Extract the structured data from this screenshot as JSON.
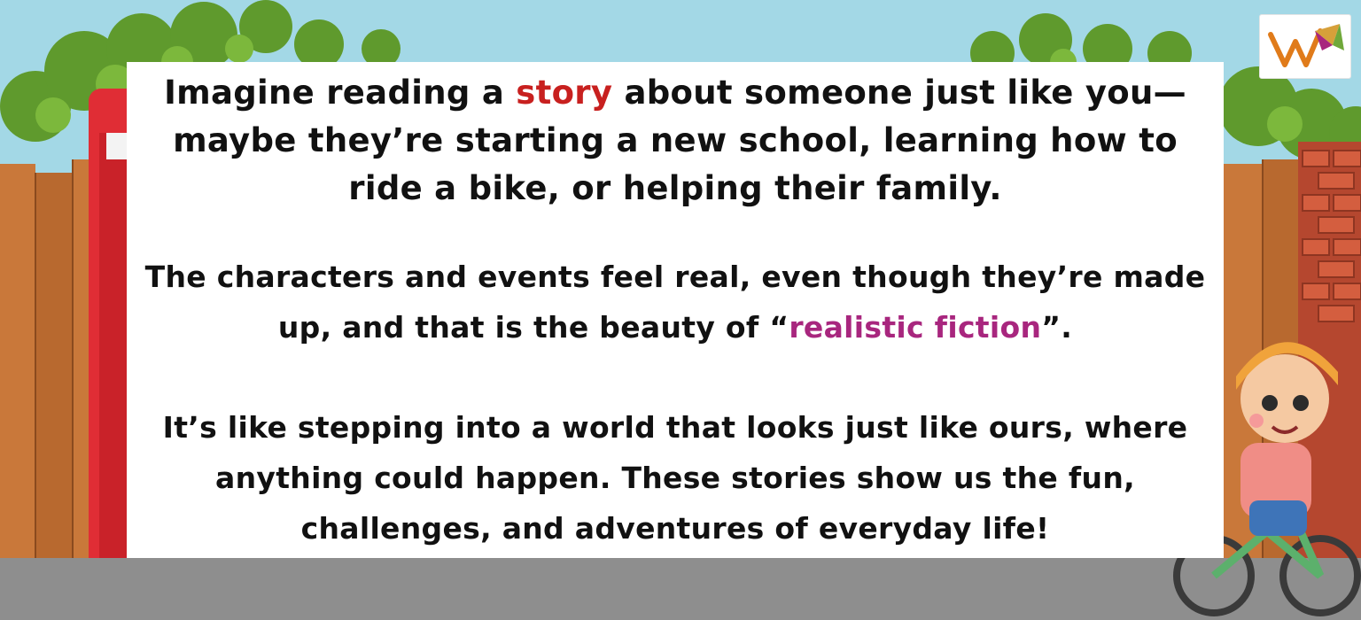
{
  "paragraphs": {
    "p1": {
      "before": "Imagine reading a ",
      "highlight": "story",
      "after": " about someone just like you— maybe they’re starting a new school, learning how to ride a bike, or helping their family."
    },
    "p2": {
      "before": "The characters and events feel real, even though they’re made up, and that is the beauty of “",
      "highlight": "realistic fiction",
      "after": "”."
    },
    "p3": {
      "text": "It’s like stepping into a world that looks just like ours, where anything could happen. These stories show us the fun, challenges, and adventures of everyday life!"
    }
  },
  "colors": {
    "highlight_story": "#c8201f",
    "highlight_realistic_fiction": "#a8267e",
    "sky": "#9fd6e4",
    "road": "#8e8e8e"
  },
  "icons": [
    "brand-logo",
    "phone-booth",
    "wooden-fence",
    "brick-wall",
    "bushes",
    "boy-on-bicycle"
  ]
}
